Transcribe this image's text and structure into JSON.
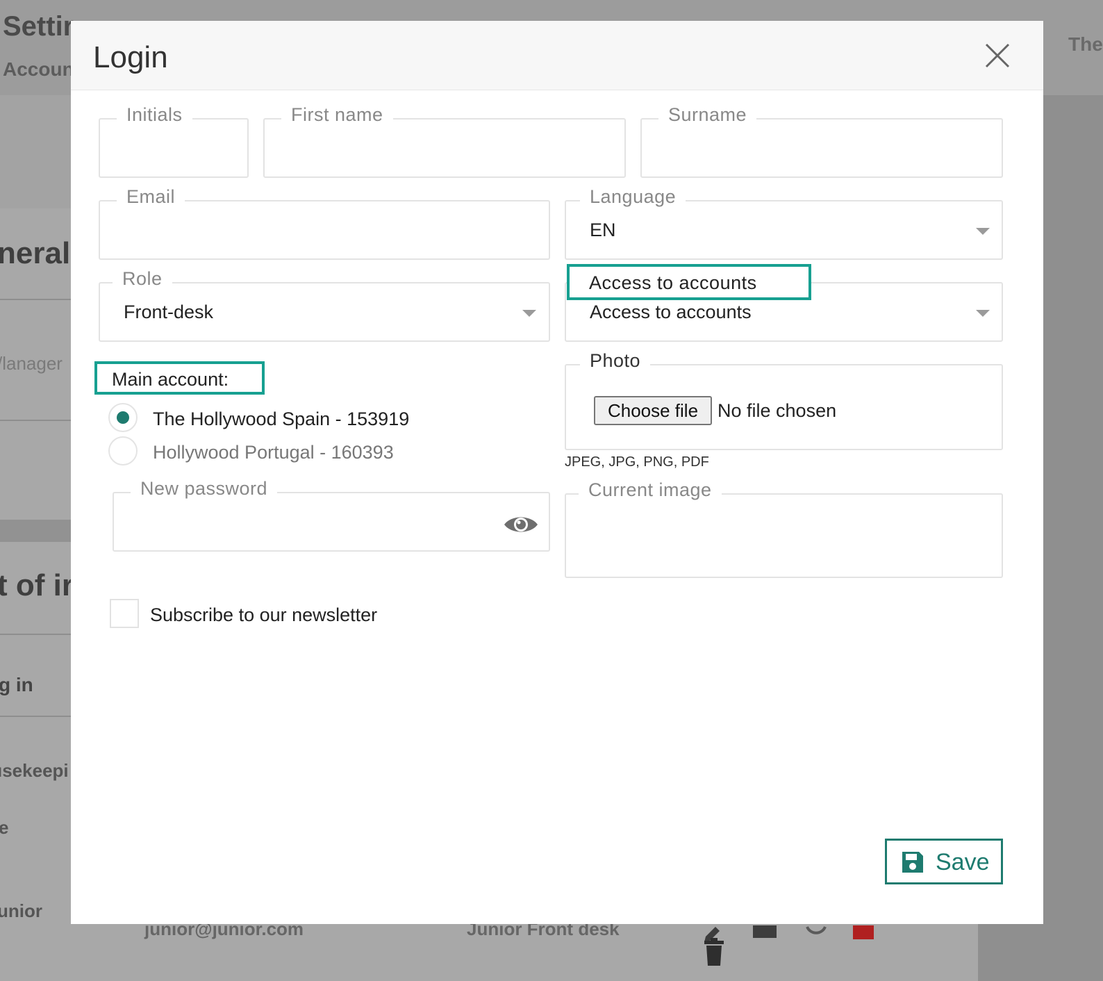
{
  "background": {
    "title_fragment": "Settir",
    "subtitle_fragment": "Accoun",
    "right_fragment": "The",
    "general_fragment": "neral",
    "manager_fragment": "/lanager",
    "list_fragment": "t of ir",
    "login_fragment": "g in",
    "housekeeping_fragment": "ısekeepi",
    "e_fragment": "e",
    "junior_fragment": "unior",
    "row_email_fragment": "junior@junior.com",
    "row_role_fragment": "Junior Front desk"
  },
  "modal": {
    "title": "Login",
    "close_icon": "close-icon"
  },
  "form": {
    "initials": {
      "label": "Initials",
      "value": ""
    },
    "first_name": {
      "label": "First name",
      "value": ""
    },
    "surname": {
      "label": "Surname",
      "value": ""
    },
    "email": {
      "label": "Email",
      "value": ""
    },
    "language": {
      "label": "Language",
      "value": "EN"
    },
    "role": {
      "label": "Role",
      "value": "Front-desk"
    },
    "access": {
      "label": "Access to accounts",
      "value": "Access to accounts"
    },
    "main_account": {
      "label": "Main account:",
      "options": [
        {
          "label": "The Hollywood Spain - 153919",
          "checked": true
        },
        {
          "label": "Hollywood Portugal - 160393",
          "checked": false
        }
      ]
    },
    "photo": {
      "label": "Photo",
      "button_label": "Choose file",
      "status": "No file chosen",
      "hint": "JPEG, JPG, PNG, PDF"
    },
    "new_password": {
      "label": "New password",
      "value": "",
      "toggle_icon": "eye-icon"
    },
    "current_image": {
      "label": "Current image"
    },
    "newsletter": {
      "label": "Subscribe to our newsletter",
      "checked": false
    },
    "save": {
      "label": "Save",
      "icon": "floppy-disk-icon"
    }
  },
  "colors": {
    "accent": "#1e7b6f",
    "highlight": "#17a091",
    "overlay": "#a3a3a3"
  }
}
